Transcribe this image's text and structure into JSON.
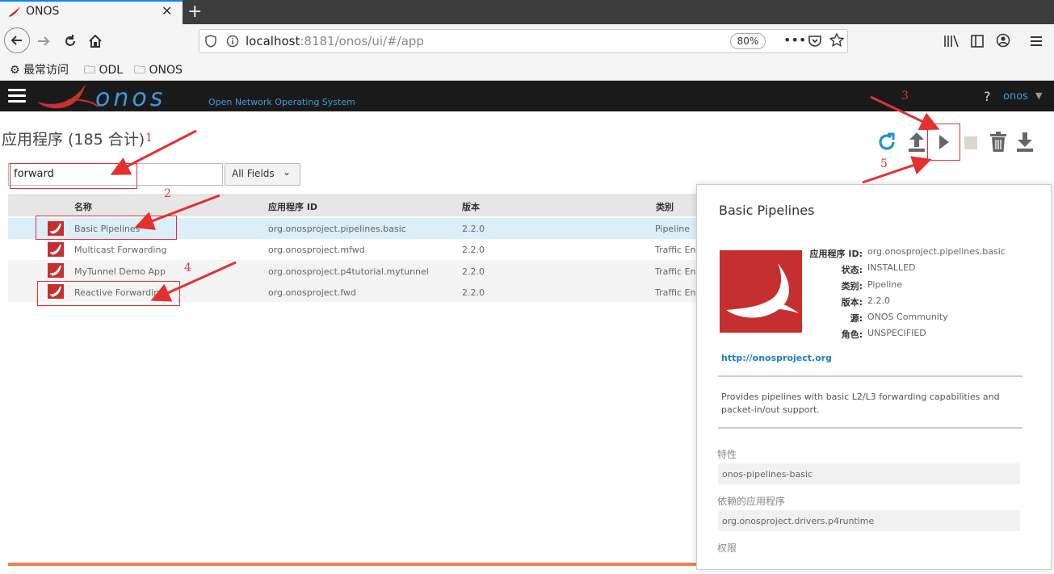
{
  "browser": {
    "tab_title": "ONOS",
    "tab_close": "✕",
    "new_tab": "+",
    "url_host": "localhost",
    "url_rest": ":8181/onos/ui/#/app",
    "zoom": "80%",
    "bookmarks": [
      "最常访问",
      "ODL",
      "ONOS"
    ]
  },
  "header": {
    "logo": "onos",
    "logo_subtitle": "Open Network Operating System",
    "help": "?",
    "user": "onos"
  },
  "page": {
    "title": "应用程序 (185 合计)",
    "search_value": "forward",
    "field_select": "All Fields"
  },
  "table": {
    "columns": [
      "名称",
      "应用程序 ID",
      "版本",
      "类别"
    ],
    "rows": [
      {
        "name": "Basic Pipelines",
        "id": "org.onosproject.pipelines.basic",
        "version": "2.2.0",
        "category": "Pipeline"
      },
      {
        "name": "Multicast Forwarding",
        "id": "org.onosproject.mfwd",
        "version": "2.2.0",
        "category": "Traffic Eng"
      },
      {
        "name": "MyTunnel Demo App",
        "id": "org.onosproject.p4tutorial.mytunnel",
        "version": "2.2.0",
        "category": "Traffic Eng"
      },
      {
        "name": "Reactive Forwarding",
        "id": "org.onosproject.fwd",
        "version": "2.2.0",
        "category": "Traffic Eng"
      }
    ]
  },
  "detail": {
    "title": "Basic Pipelines",
    "fields": [
      {
        "label": "应用程序 ID:",
        "value": "org.onosproject.pipelines.basic"
      },
      {
        "label": "状态:",
        "value": "INSTALLED"
      },
      {
        "label": "类别:",
        "value": "Pipeline"
      },
      {
        "label": "版本:",
        "value": "2.2.0"
      },
      {
        "label": "源:",
        "value": "ONOS Community"
      },
      {
        "label": "角色:",
        "value": "UNSPECIFIED"
      }
    ],
    "link": "http://onosproject.org",
    "description": "Provides pipelines with basic L2/L3 forwarding capabilities and packet-in/out support.",
    "features_label": "特性",
    "features_value": "onos-pipelines-basic",
    "deps_label": "依赖的应用程序",
    "deps_value": "org.onosproject.drivers.p4runtime",
    "perms_label": "权限"
  },
  "annotations": [
    "1",
    "2",
    "3",
    "4",
    "5"
  ],
  "colors": {
    "accent": "#3a9bd9",
    "app_red": "#c62f2f",
    "selected_row": "#dbeefa",
    "annotation": "#e53030"
  }
}
